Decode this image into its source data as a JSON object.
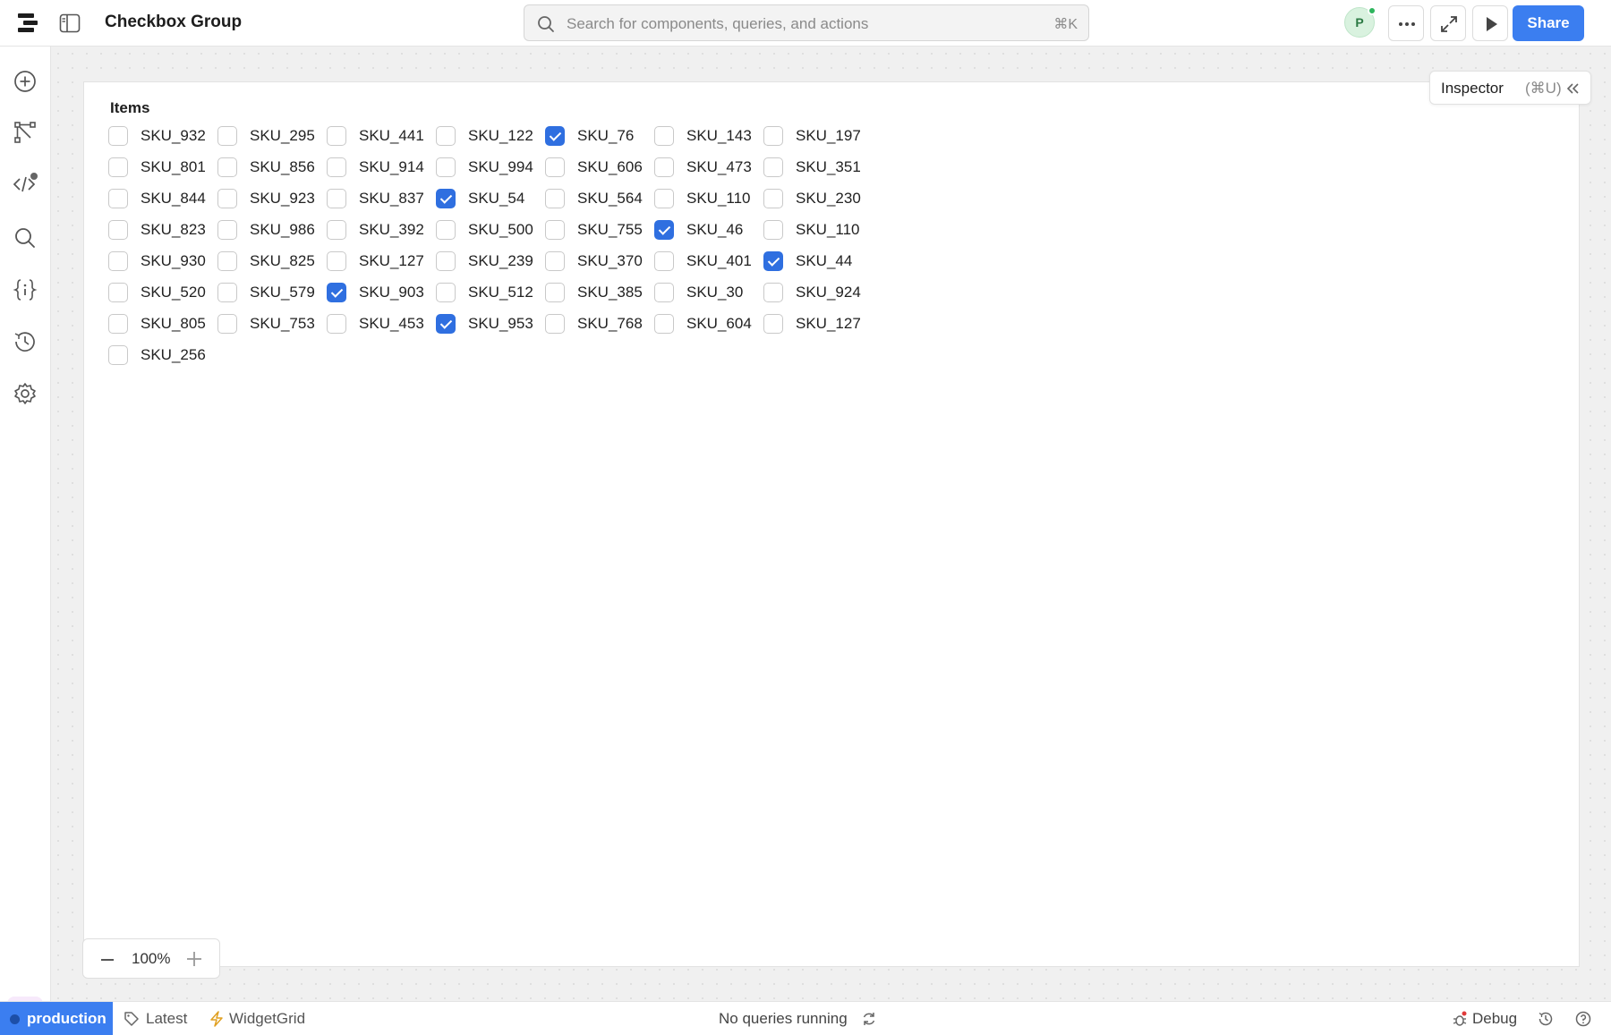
{
  "app": {
    "title": "Checkbox Group"
  },
  "search": {
    "placeholder": "Search for components, queries, and actions",
    "shortcut": "⌘K"
  },
  "user": {
    "initial": "P",
    "online_color": "#2db55d"
  },
  "toolbar": {
    "share_label": "Share"
  },
  "colors": {
    "accent": "#3b7ef0",
    "checked": "#2f6fe0"
  },
  "rail": {
    "items": [
      {
        "icon": "plus-circle-icon"
      },
      {
        "icon": "workflow-icon"
      },
      {
        "icon": "code-icon"
      },
      {
        "icon": "search-icon"
      },
      {
        "icon": "variables-icon"
      },
      {
        "icon": "history-icon"
      },
      {
        "icon": "settings-icon"
      }
    ],
    "assistant_icon": "sparkle-icon"
  },
  "inspector": {
    "label": "Inspector",
    "shortcut": "(⌘U)"
  },
  "checkbox_group": {
    "label": "Items",
    "rows": [
      [
        {
          "label": "SKU_932",
          "checked": false
        },
        {
          "label": "SKU_295",
          "checked": false
        },
        {
          "label": "SKU_441",
          "checked": false
        },
        {
          "label": "SKU_122",
          "checked": false
        },
        {
          "label": "SKU_76",
          "checked": true
        },
        {
          "label": "SKU_143",
          "checked": false
        },
        {
          "label": "SKU_197",
          "checked": false
        }
      ],
      [
        {
          "label": "SKU_801",
          "checked": false
        },
        {
          "label": "SKU_856",
          "checked": false
        },
        {
          "label": "SKU_914",
          "checked": false
        },
        {
          "label": "SKU_994",
          "checked": false
        },
        {
          "label": "SKU_606",
          "checked": false
        },
        {
          "label": "SKU_473",
          "checked": false
        },
        {
          "label": "SKU_351",
          "checked": false
        }
      ],
      [
        {
          "label": "SKU_844",
          "checked": false
        },
        {
          "label": "SKU_923",
          "checked": false
        },
        {
          "label": "SKU_837",
          "checked": false
        },
        {
          "label": "SKU_54",
          "checked": true
        },
        {
          "label": "SKU_564",
          "checked": false
        },
        {
          "label": "SKU_110",
          "checked": false
        },
        {
          "label": "SKU_230",
          "checked": false
        }
      ],
      [
        {
          "label": "SKU_823",
          "checked": false
        },
        {
          "label": "SKU_986",
          "checked": false
        },
        {
          "label": "SKU_392",
          "checked": false
        },
        {
          "label": "SKU_500",
          "checked": false
        },
        {
          "label": "SKU_755",
          "checked": false
        },
        {
          "label": "SKU_46",
          "checked": true
        },
        {
          "label": "SKU_110",
          "checked": false
        }
      ],
      [
        {
          "label": "SKU_930",
          "checked": false
        },
        {
          "label": "SKU_825",
          "checked": false
        },
        {
          "label": "SKU_127",
          "checked": false
        },
        {
          "label": "SKU_239",
          "checked": false
        },
        {
          "label": "SKU_370",
          "checked": false
        },
        {
          "label": "SKU_401",
          "checked": false
        },
        {
          "label": "SKU_44",
          "checked": true
        }
      ],
      [
        {
          "label": "SKU_520",
          "checked": false
        },
        {
          "label": "SKU_579",
          "checked": false
        },
        {
          "label": "SKU_903",
          "checked": true
        },
        {
          "label": "SKU_512",
          "checked": false
        },
        {
          "label": "SKU_385",
          "checked": false
        },
        {
          "label": "SKU_30",
          "checked": false
        },
        {
          "label": "SKU_924",
          "checked": false
        }
      ],
      [
        {
          "label": "SKU_805",
          "checked": false
        },
        {
          "label": "SKU_753",
          "checked": false
        },
        {
          "label": "SKU_453",
          "checked": false
        },
        {
          "label": "SKU_953",
          "checked": true
        },
        {
          "label": "SKU_768",
          "checked": false
        },
        {
          "label": "SKU_604",
          "checked": false
        },
        {
          "label": "SKU_127",
          "checked": false
        }
      ],
      [
        {
          "label": "SKU_256",
          "checked": false
        }
      ]
    ]
  },
  "zoom": {
    "value": "100%"
  },
  "statusbar": {
    "environment": "production",
    "branch": "Latest",
    "grid_label": "WidgetGrid",
    "status": "No queries running",
    "debug_label": "Debug"
  }
}
